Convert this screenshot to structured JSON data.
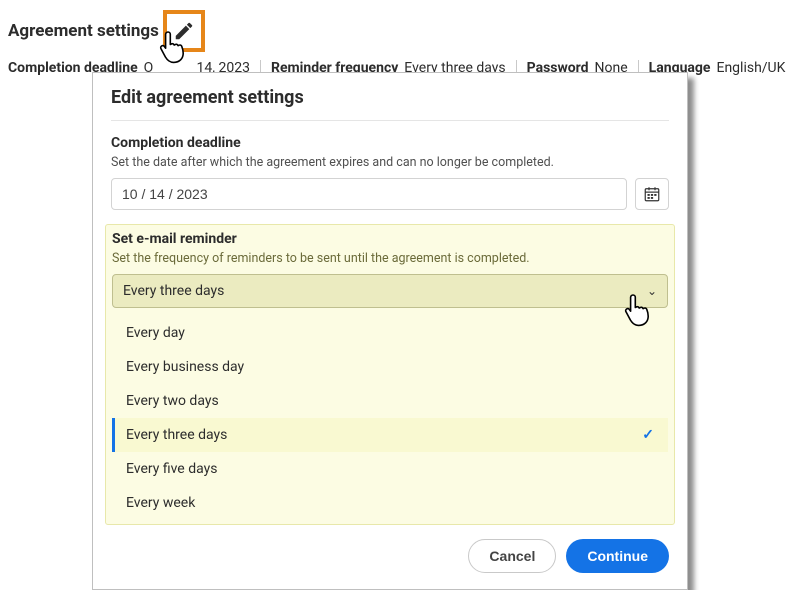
{
  "page": {
    "title": "Agreement settings"
  },
  "meta": {
    "deadline_label": "Completion deadline",
    "deadline_value_prefix": "O",
    "deadline_value_suffix": "14, 2023",
    "reminder_label": "Reminder frequency",
    "reminder_value": "Every three days",
    "password_label": "Password",
    "password_value": "None",
    "language_label": "Language",
    "language_value": "English/UK"
  },
  "modal": {
    "title": "Edit agreement settings",
    "deadline_title": "Completion deadline",
    "deadline_desc": "Set the date after which the agreement expires and can no longer be completed.",
    "date_value": "10 / 14 / 2023",
    "reminder_title": "Set e-mail reminder",
    "reminder_desc": "Set the frequency of reminders to be sent until the agreement is completed.",
    "reminder_selected": "Every three days",
    "options": [
      "Every day",
      "Every business day",
      "Every two days",
      "Every three days",
      "Every five days",
      "Every week"
    ],
    "cancel": "Cancel",
    "continue": "Continue"
  }
}
